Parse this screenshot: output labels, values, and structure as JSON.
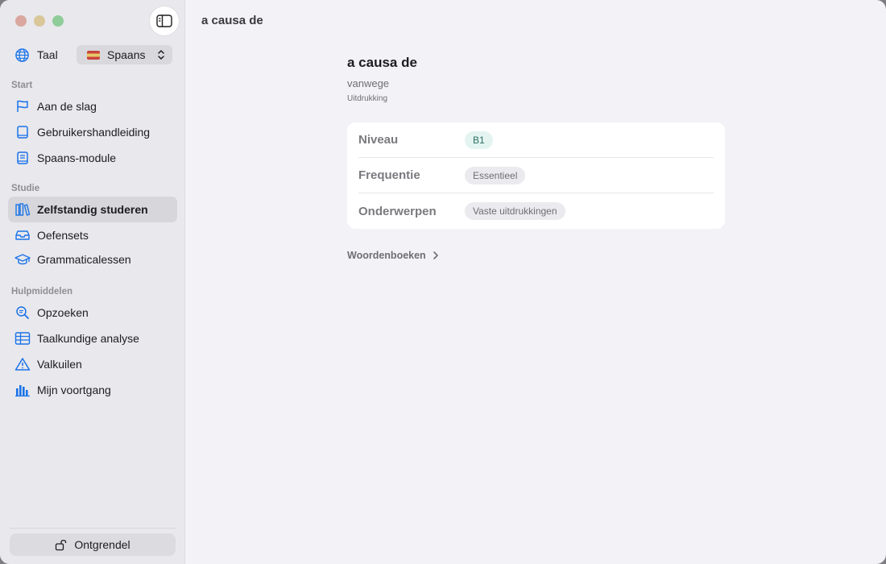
{
  "window": {
    "title": "a causa de"
  },
  "sidebar": {
    "language_label": "Taal",
    "language_value": "Spaans",
    "sections": [
      {
        "label": "Start",
        "items": [
          {
            "label": "Aan de slag",
            "icon": "flag-icon"
          },
          {
            "label": "Gebruikershandleiding",
            "icon": "book-icon"
          },
          {
            "label": "Spaans-module",
            "icon": "module-book-icon"
          }
        ]
      },
      {
        "label": "Studie",
        "items": [
          {
            "label": "Zelfstandig studeren",
            "icon": "books-icon",
            "active": true
          },
          {
            "label": "Oefensets",
            "icon": "tray-icon"
          },
          {
            "label": "Grammaticalessen",
            "icon": "graduation-cap-icon"
          }
        ]
      },
      {
        "label": "Hulpmiddelen",
        "items": [
          {
            "label": "Opzoeken",
            "icon": "search-icon"
          },
          {
            "label": "Taalkundige analyse",
            "icon": "table-icon"
          },
          {
            "label": "Valkuilen",
            "icon": "warning-icon"
          },
          {
            "label": "Mijn voortgang",
            "icon": "bar-chart-icon"
          }
        ]
      }
    ],
    "unlock_label": "Ontgrendel"
  },
  "entry": {
    "word": "a causa de",
    "translation": "vanwege",
    "kind": "Uitdrukking",
    "details": [
      {
        "key": "Niveau",
        "value": "B1"
      },
      {
        "key": "Frequentie",
        "value": "Essentieel"
      },
      {
        "key": "Onderwerpen",
        "value": "Vaste uitdrukkingen"
      }
    ],
    "dictionaries_label": "Woordenboeken"
  },
  "colors": {
    "accent": "#1a73e8",
    "level_chip": "#e3f4f1"
  }
}
